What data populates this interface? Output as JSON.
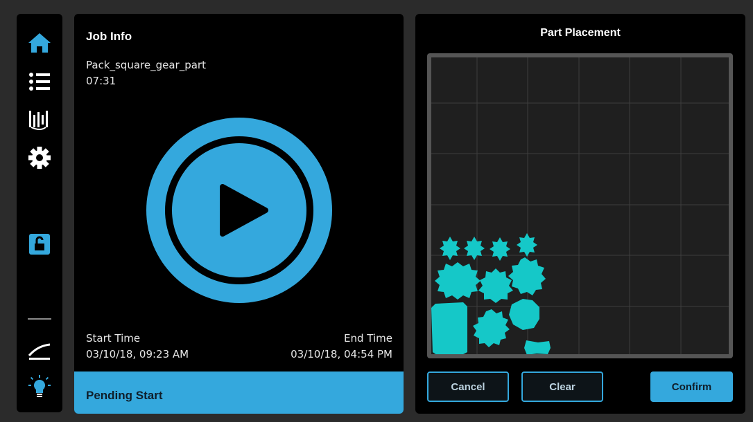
{
  "sidebar": {
    "items": [
      {
        "icon": "home-icon"
      },
      {
        "icon": "list-icon"
      },
      {
        "icon": "ruler-icon"
      },
      {
        "icon": "gear-icon"
      },
      {
        "icon": "unlock-icon"
      },
      {
        "icon": "minus-icon"
      },
      {
        "icon": "curve-icon"
      },
      {
        "icon": "lightbulb-icon"
      }
    ]
  },
  "job_info": {
    "title": "Job Info",
    "job_name": "Pack_square_gear_part",
    "duration": "07:31",
    "start_label": "Start Time",
    "start_value": "03/10/18, 09:23 AM",
    "end_label": "End Time",
    "end_value": "03/10/18, 04:54 PM",
    "status": "Pending Start"
  },
  "placement": {
    "title": "Part Placement",
    "cancel_label": "Cancel",
    "clear_label": "Clear",
    "confirm_label": "Confirm"
  },
  "colors": {
    "accent": "#34a8dd",
    "part": "#15c8c8",
    "grid_bg": "#1f1f1f",
    "panel_bg": "#000000"
  }
}
